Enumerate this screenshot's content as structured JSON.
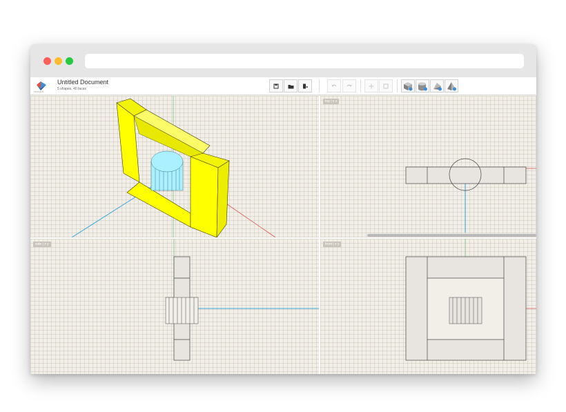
{
  "app": {
    "logo_text": "TRIGUS",
    "doc_title": "Untitled Document",
    "doc_subtitle": "5 shapes, 40 faces"
  },
  "toolbar": {
    "file_buttons": [
      "save-icon",
      "open-folder-icon",
      "export-icon"
    ],
    "history_buttons": [
      "undo-icon",
      "redo-icon"
    ],
    "transform_buttons": [
      "move-icon",
      "select-box-icon"
    ],
    "shape_buttons": [
      "add-box-icon",
      "add-cylinder-icon",
      "add-prism-icon",
      "add-pyramid-icon"
    ]
  },
  "viewports": {
    "perspective": {
      "label": ""
    },
    "top": {
      "label": "top | x z"
    },
    "side": {
      "label": "side | z y"
    },
    "front": {
      "label": "front | x y"
    }
  },
  "colors": {
    "shape_yellow": "#ffff00",
    "shape_cyan": "#aaf0ff",
    "axis_blue": "#3aa7e0",
    "axis_red": "#e05050",
    "axis_green": "#7cc48a",
    "traffic_red": "#ff5f56",
    "traffic_yellow": "#ffbd2e",
    "traffic_green": "#27c93f"
  }
}
